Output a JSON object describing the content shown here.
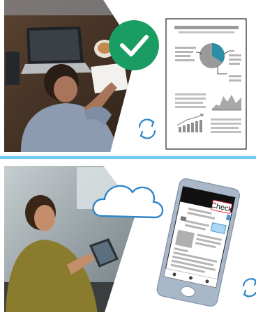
{
  "colors": {
    "accent_green": "#1a9d63",
    "divider_blue": "#73c9ee",
    "sync_blue": "#2f86c8",
    "cloud_blue": "#2f86c8",
    "chart_teal": "#2a8fa6",
    "check_red": "#e2262b",
    "phone_body": "#a9b8c9",
    "highlight_blue": "#a9d6f2"
  },
  "icons": {
    "top_badge": "checkmark-icon",
    "top_sync": "sync-icon",
    "bottom_cloud": "cloud-icon",
    "bottom_sync": "sync-icon"
  },
  "phone": {
    "stamp_label": "Check"
  }
}
